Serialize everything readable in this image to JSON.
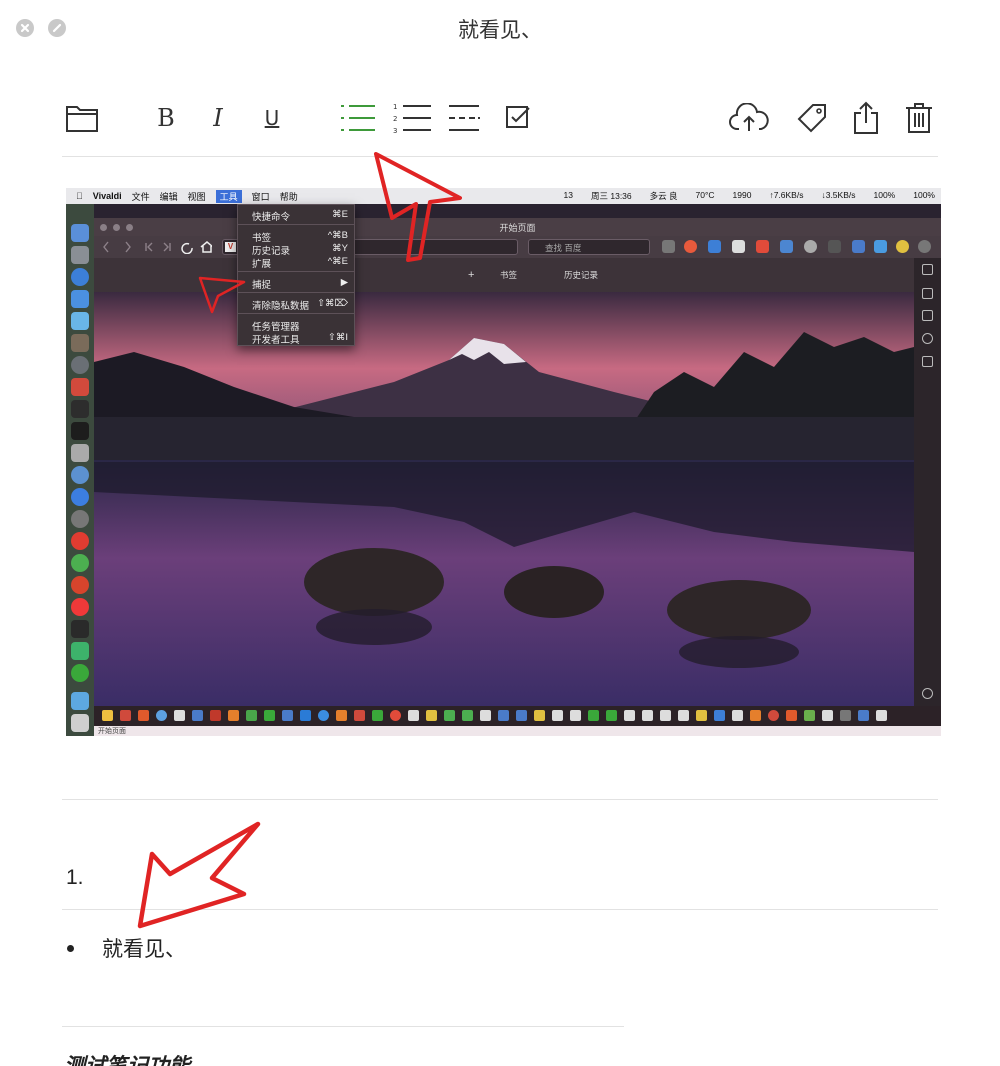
{
  "window": {
    "title": "就看见、"
  },
  "toolbar": {
    "bold_label": "B",
    "italic_label": "I",
    "underline_label": "U",
    "icons": [
      "folder-icon",
      "bullet-list-icon",
      "numbered-list-icon",
      "divider-icon",
      "checkbox-icon",
      "cloud-upload-icon",
      "tag-icon",
      "share-icon",
      "trash-icon"
    ],
    "active_color": "#3e9a3a"
  },
  "screenshot": {
    "menubar": {
      "app": "Vivaldi",
      "menus": [
        "文件",
        "编辑",
        "视图",
        "工具",
        "窗口",
        "帮助"
      ],
      "active_menu": "工具",
      "status_time": "周三 13:36",
      "weather": "多云 良",
      "network_up": "↑7.6KB/s",
      "network_down": "↓3.5KB/s",
      "temp": "70°C",
      "rpm": "1990",
      "badge_count": "13",
      "battery_1": "100%",
      "battery_2": "100%"
    },
    "browser": {
      "tab_title": "开始页面",
      "search_placeholder": "查找 百度",
      "bookmarks_label": "书签",
      "history_label": "历史记录",
      "bottom_tab": "开始页面"
    },
    "tools_menu": {
      "items": [
        {
          "label": "快捷命令",
          "shortcut": "⌘E"
        },
        {
          "label": "书签",
          "shortcut": "^⌘B"
        },
        {
          "label": "历史记录",
          "shortcut": "⌘Y"
        },
        {
          "label": "扩展",
          "shortcut": "^⌘E"
        },
        {
          "label": "捕捉",
          "shortcut": "▶"
        },
        {
          "label": "清除隐私数据",
          "shortcut": "⇧⌘⌦"
        },
        {
          "label": "任务管理器",
          "shortcut": ""
        },
        {
          "label": "开发者工具",
          "shortcut": "⇧⌘I"
        }
      ]
    }
  },
  "document": {
    "numbered_item": "1.",
    "bullet_item": "就看见、",
    "note_title": "测试笔记功能"
  }
}
